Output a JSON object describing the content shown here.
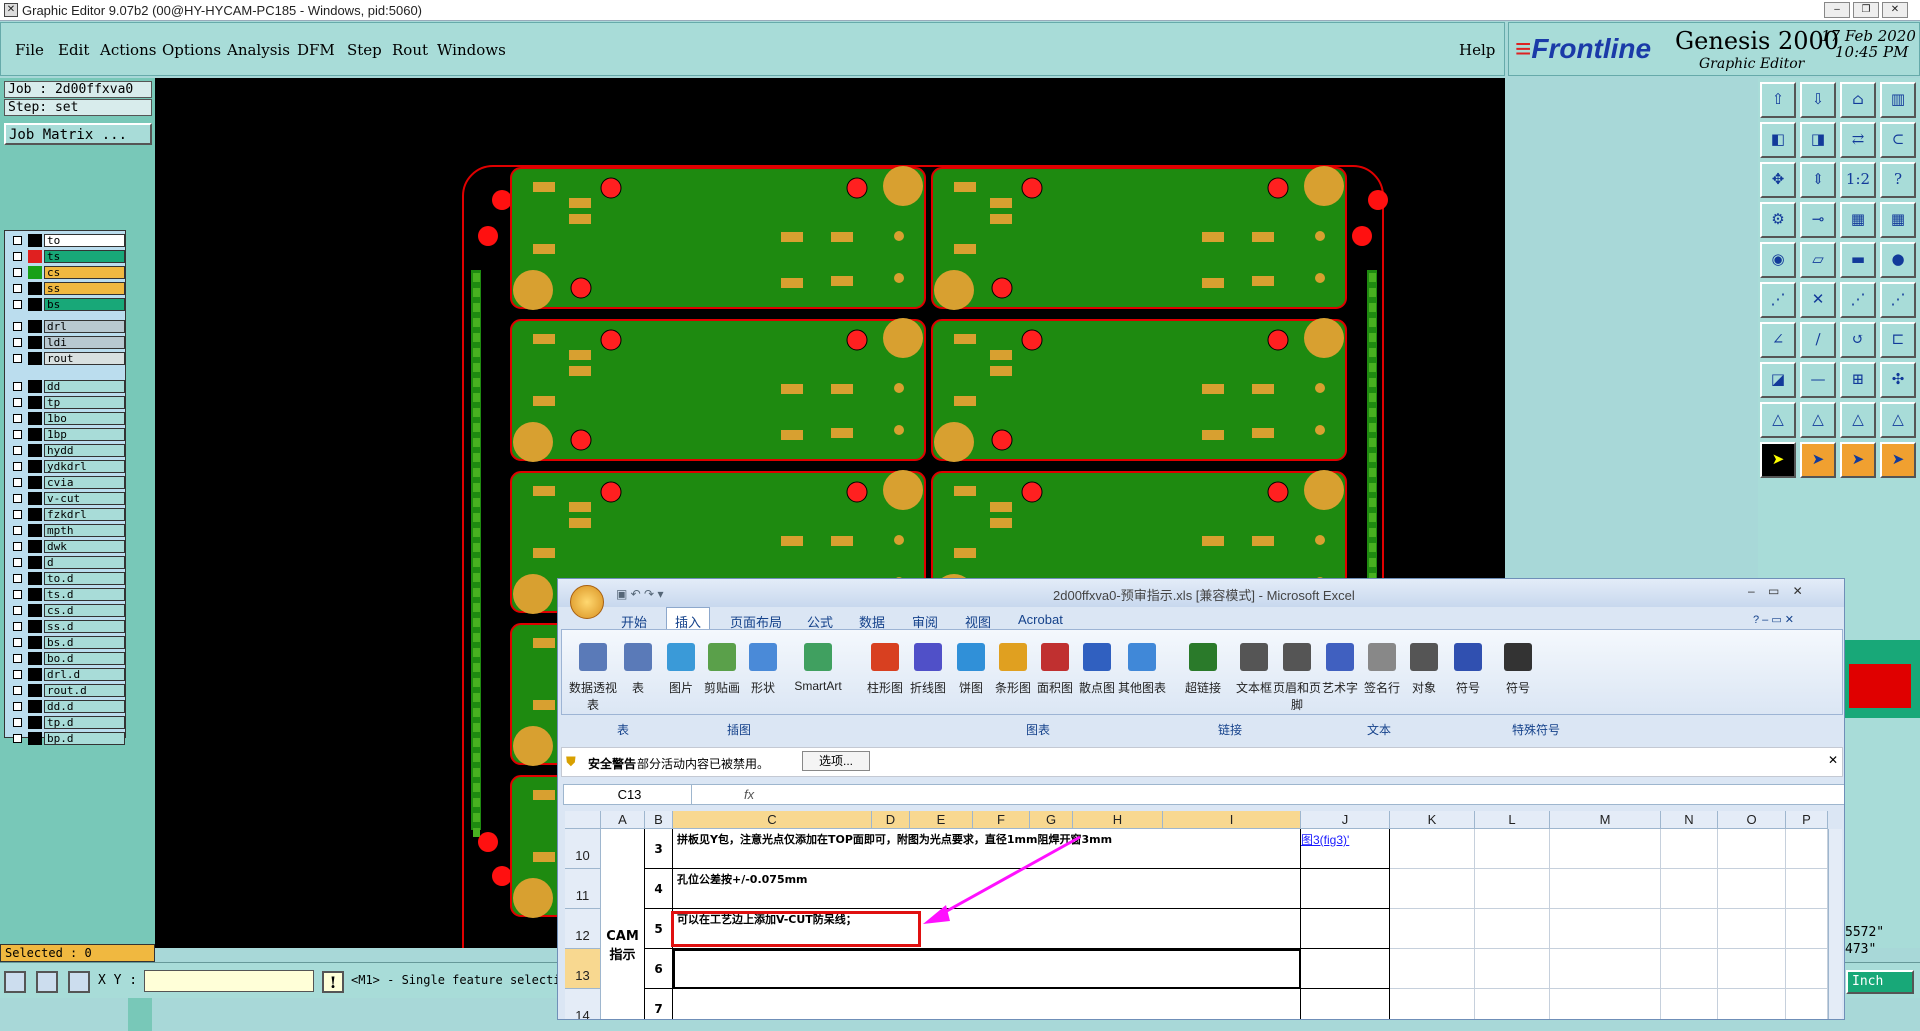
{
  "window": {
    "title": "Graphic Editor 9.07b2 (00@HY-HYCAM-PC185 - Windows, pid:5060)"
  },
  "menu": [
    "File",
    "Edit",
    "Actions",
    "Options",
    "Analysis",
    "DFM",
    "Step",
    "Rout",
    "Windows"
  ],
  "help": "Help",
  "brand": {
    "logo": "Frontline",
    "product": "Genesis 2000",
    "subtitle": "Graphic Editor",
    "date": "17 Feb 2020",
    "time": "10:45 PM"
  },
  "job": {
    "job": "Job : 2d00ffxva0",
    "step": "Step: set",
    "matrix_button": "Job Matrix ..."
  },
  "layers": [
    {
      "name": "to",
      "color": "#000000",
      "bg": "#ffffff"
    },
    {
      "name": "ts",
      "color": "#e02020",
      "bg": "#18a878"
    },
    {
      "name": "cs",
      "color": "#18a018",
      "bg": "#f0b840"
    },
    {
      "name": "ss",
      "color": "#000000",
      "bg": "#f0b840"
    },
    {
      "name": "bs",
      "color": "#000000",
      "bg": "#18a878"
    },
    {
      "name": "drl",
      "color": "#000000",
      "bg": "#b8c8d0"
    },
    {
      "name": "ldi",
      "color": "#000000",
      "bg": "#b8c8d0"
    },
    {
      "name": "rout",
      "color": "#000000",
      "bg": "#d8e0e0"
    },
    {
      "name": "dd",
      "color": "#000000",
      "bg": "#a8dcd8"
    },
    {
      "name": "tp",
      "color": "#000000",
      "bg": "#a8dcd8"
    },
    {
      "name": "1bo",
      "color": "#000000",
      "bg": "#a8dcd8"
    },
    {
      "name": "1bp",
      "color": "#000000",
      "bg": "#a8dcd8"
    },
    {
      "name": "hydd",
      "color": "#000000",
      "bg": "#a8dcd8"
    },
    {
      "name": "ydkdrl",
      "color": "#000000",
      "bg": "#a8dcd8"
    },
    {
      "name": "cvia",
      "color": "#000000",
      "bg": "#a8dcd8"
    },
    {
      "name": "v-cut",
      "color": "#000000",
      "bg": "#a8dcd8"
    },
    {
      "name": "fzkdrl",
      "color": "#000000",
      "bg": "#a8dcd8"
    },
    {
      "name": "mpth",
      "color": "#000000",
      "bg": "#a8dcd8"
    },
    {
      "name": "dwk",
      "color": "#000000",
      "bg": "#a8dcd8"
    },
    {
      "name": "d",
      "color": "#000000",
      "bg": "#a8dcd8"
    },
    {
      "name": "to.d",
      "color": "#000000",
      "bg": "#a8dcd8"
    },
    {
      "name": "ts.d",
      "color": "#000000",
      "bg": "#a8dcd8"
    },
    {
      "name": "cs.d",
      "color": "#000000",
      "bg": "#a8dcd8"
    },
    {
      "name": "ss.d",
      "color": "#000000",
      "bg": "#a8dcd8"
    },
    {
      "name": "bs.d",
      "color": "#000000",
      "bg": "#a8dcd8"
    },
    {
      "name": "bo.d",
      "color": "#000000",
      "bg": "#a8dcd8"
    },
    {
      "name": "drl.d",
      "color": "#000000",
      "bg": "#a8dcd8"
    },
    {
      "name": "rout.d",
      "color": "#000000",
      "bg": "#a8dcd8"
    },
    {
      "name": "dd.d",
      "color": "#000000",
      "bg": "#a8dcd8"
    },
    {
      "name": "tp.d",
      "color": "#000000",
      "bg": "#a8dcd8"
    },
    {
      "name": "bp.d",
      "color": "#000000",
      "bg": "#a8dcd8"
    }
  ],
  "status": {
    "selected": "Selected : 0",
    "xy_label": "X Y :",
    "hint": "<M1> - Single feature selecti",
    "units": "Inch",
    "coord1": "5572\"",
    "coord2": "473\""
  },
  "excel": {
    "title": "2d00ffxva0-预审指示.xls [兼容模式] - Microsoft Excel",
    "tabs": [
      "开始",
      "插入",
      "页面布局",
      "公式",
      "数据",
      "审阅",
      "视图",
      "Acrobat"
    ],
    "active_tab": "插入",
    "ribbon_items": [
      "数据透视表",
      "表",
      "图片",
      "剪贴画",
      "形状",
      "SmartArt",
      "柱形图",
      "折线图",
      "饼图",
      "条形图",
      "面积图",
      "散点图",
      "其他图表",
      "超链接",
      "文本框",
      "页眉和页脚",
      "艺术字",
      "签名行",
      "对象",
      "符号",
      "符号"
    ],
    "groups": [
      "表",
      "插图",
      "图表",
      "链接",
      "文本",
      "特殊符号"
    ],
    "security": {
      "title": "安全警告",
      "text": "部分活动内容已被禁用。",
      "button": "选项..."
    },
    "namebox": "C13",
    "fx": "fx",
    "columns": [
      "A",
      "B",
      "C",
      "D",
      "E",
      "F",
      "G",
      "H",
      "I",
      "J",
      "K",
      "L",
      "M",
      "N",
      "O",
      "P"
    ],
    "rows": [
      {
        "num": "10",
        "b": "3",
        "c": "拼板见Y包，注意光点仅添加在TOP面即可，附图为光点要求，直径1mm阻焊开窗3mm",
        "j": "图3(fig3)'"
      },
      {
        "num": "11",
        "b": "4",
        "c": "孔位公差按+/-0.075mm",
        "j": ""
      },
      {
        "num": "12",
        "b": "5",
        "c": "可以在工艺边上添加V-CUT防呆线；",
        "j": ""
      },
      {
        "num": "13",
        "b": "6",
        "c": "",
        "j": ""
      },
      {
        "num": "14",
        "b": "7",
        "c": "",
        "j": ""
      }
    ],
    "merged_a": "CAM指示"
  }
}
